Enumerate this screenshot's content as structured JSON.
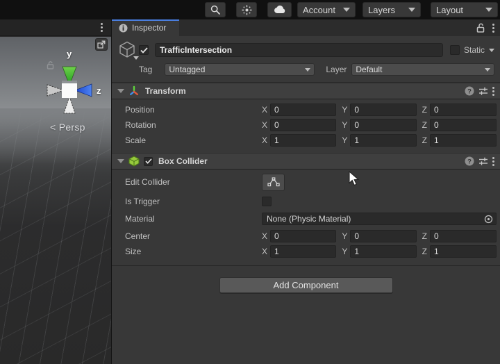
{
  "toolbar": {
    "account": {
      "label": "Account"
    },
    "layers": {
      "label": "Layers"
    },
    "layout": {
      "label": "Layout"
    }
  },
  "scene_view": {
    "persp_prefix": "<",
    "persp_label": "Persp",
    "gizmo": {
      "y_axis_label": "y",
      "z_axis_label": "z"
    }
  },
  "inspector": {
    "tab_label": "Inspector",
    "game_object": {
      "name_value": "TrafficIntersection",
      "static_label": "Static",
      "tag_label": "Tag",
      "tag_value": "Untagged",
      "layer_label": "Layer",
      "layer_value": "Default"
    },
    "axes": {
      "x": "X",
      "y": "Y",
      "z": "Z"
    },
    "transform": {
      "title": "Transform",
      "rows": [
        {
          "label": "Position",
          "x": "0",
          "y": "0",
          "z": "0"
        },
        {
          "label": "Rotation",
          "x": "0",
          "y": "0",
          "z": "0"
        },
        {
          "label": "Scale",
          "x": "1",
          "y": "1",
          "z": "1"
        }
      ]
    },
    "box_collider": {
      "title": "Box Collider",
      "edit_collider_label": "Edit Collider",
      "is_trigger_label": "Is Trigger",
      "material_label": "Material",
      "material_value": "None (Physic Material)",
      "center": {
        "label": "Center",
        "x": "0",
        "y": "0",
        "z": "0"
      },
      "size": {
        "label": "Size",
        "x": "1",
        "y": "1",
        "z": "1"
      }
    },
    "add_component_label": "Add Component"
  },
  "colors": {
    "active_tab_accent": "#4a7fe0",
    "gizmo_y_green": "#2fae2b",
    "gizmo_z_blue": "#2e5fd8",
    "collider_icon_green": "#97c93d",
    "panel_background": "#383838"
  }
}
